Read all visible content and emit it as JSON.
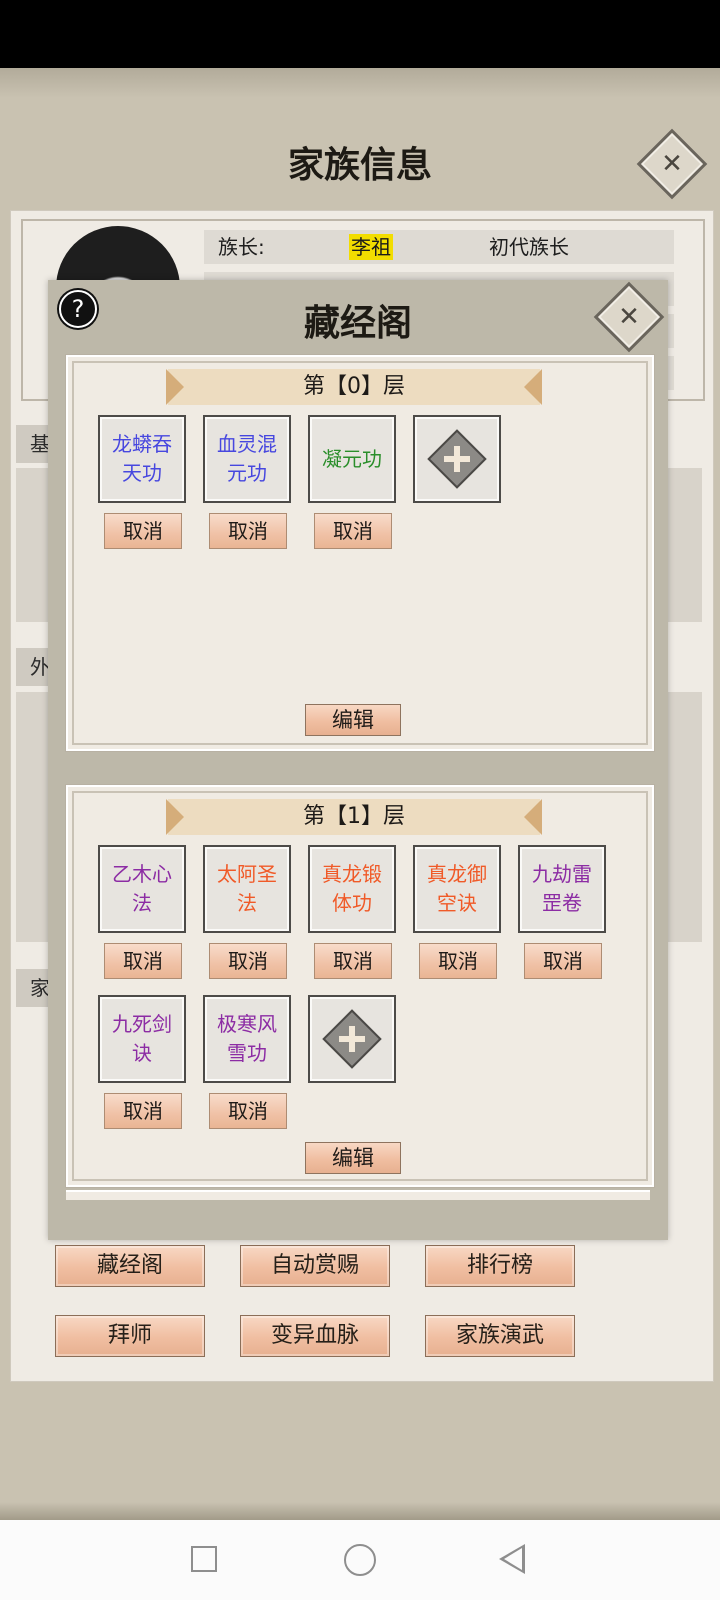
{
  "family": {
    "title": "家族信息",
    "leader_label": "族长:",
    "leader_name": "李祖",
    "leader_title": "初代族长",
    "section_labels": [
      "基",
      "外",
      "家"
    ]
  },
  "buttons": {
    "row1": [
      "藏经阁",
      "自动赏赐",
      "排行榜"
    ],
    "row2": [
      "拜师",
      "变异血脉",
      "家族演武"
    ]
  },
  "dialog": {
    "title": "藏经阁",
    "layers": [
      {
        "header": "第【0】层",
        "skills": [
          {
            "name": "龙蟒吞天功",
            "color": "#4747df"
          },
          {
            "name": "血灵混元功",
            "color": "#4747df"
          },
          {
            "name": "凝元功",
            "color": "#2a8e2a"
          }
        ],
        "cancel_label": "取消",
        "edit_label": "编辑"
      },
      {
        "header": "第【1】层",
        "skills": [
          {
            "name": "乙木心法",
            "color": "#8c2ca4"
          },
          {
            "name": "太阿圣法",
            "color": "#f05a28"
          },
          {
            "name": "真龙锻体功",
            "color": "#f05a28"
          },
          {
            "name": "真龙御空诀",
            "color": "#f05a28"
          },
          {
            "name": "九劫雷罡卷",
            "color": "#8c2ca4"
          },
          {
            "name": "九死剑诀",
            "color": "#8c2ca4"
          },
          {
            "name": "极寒风雪功",
            "color": "#8c2ca4"
          }
        ],
        "cancel_label": "取消",
        "edit_label": "编辑"
      }
    ]
  },
  "icons": {
    "close": "close-icon",
    "help": "help-icon",
    "add": "plus-icon",
    "arrow_left": "arrow-left-icon",
    "arrow_right": "arrow-right-icon"
  }
}
